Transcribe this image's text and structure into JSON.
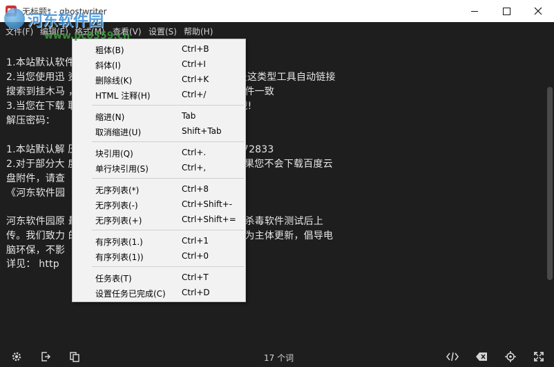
{
  "window": {
    "title": "无标题* - ghostwriter",
    "minimize_icon": "minimize-icon",
    "maximize_icon": "maximize-icon",
    "close_icon": "close-icon"
  },
  "watermark": {
    "text": "河东软件园",
    "url": "www.pc0359.cn"
  },
  "menubar": {
    "items": [
      {
        "label": "文件(F)"
      },
      {
        "label": "编辑(E)"
      },
      {
        "label": "格式(M)"
      },
      {
        "label": "查看(V)"
      },
      {
        "label": "设置(S)"
      },
      {
        "label": "帮助(H)"
      }
    ]
  },
  "editor": {
    "lines": [
      "1.本站默认软件 使用请使用 WinRAR 解压本站软件。",
      "2.当您使用迅 资源，发现MD5值验证不对时，很可能是这类型工具自动链接",
      "搜索到挂木马 ，验证下载后的文件是否与服务器上的文件一致",
      "3.当您在下载 联系QQ：3187272833 寻求解决方法哦!",
      "解压密码：",
      "",
      "1.本站默认解 压密码不正确，请联系客服QQ：3187272833",
      "2.对于部分大 度，我们将附件上传到了百度云盘中，如果您不会下载百度云",
      "盘附件，请查",
      "《河东软件园",
      "",
      "河东软件园原 最安全的绿色软件下载，本站软件均经过杀毒软件测试后上",
      "传。我们致力 的电脑软件深受用户好评，并以绿色软件为主体更新，倡导电",
      "脑环保，不影",
      "详见： http"
    ]
  },
  "context_menu": {
    "groups": [
      [
        {
          "label": "粗体(B)",
          "shortcut": "Ctrl+B"
        },
        {
          "label": "斜体(I)",
          "shortcut": "Ctrl+I"
        },
        {
          "label": "删除线(K)",
          "shortcut": "Ctrl+K"
        },
        {
          "label": "HTML 注释(H)",
          "shortcut": "Ctrl+/"
        }
      ],
      [
        {
          "label": "缩进(N)",
          "shortcut": "Tab"
        },
        {
          "label": "取消缩进(U)",
          "shortcut": "Shift+Tab"
        }
      ],
      [
        {
          "label": "块引用(Q)",
          "shortcut": "Ctrl+."
        },
        {
          "label": "单行块引用(S)",
          "shortcut": "Ctrl+,"
        }
      ],
      [
        {
          "label": "无序列表(*)",
          "shortcut": "Ctrl+8"
        },
        {
          "label": "无序列表(-)",
          "shortcut": "Ctrl+Shift+-"
        },
        {
          "label": "无序列表(+)",
          "shortcut": "Ctrl+Shift+="
        }
      ],
      [
        {
          "label": "有序列表(1.)",
          "shortcut": "Ctrl+1"
        },
        {
          "label": "有序列表(1))",
          "shortcut": "Ctrl+0"
        }
      ],
      [
        {
          "label": "任务表(T)",
          "shortcut": "Ctrl+T"
        },
        {
          "label": "设置任务已完成(C)",
          "shortcut": "Ctrl+D"
        }
      ]
    ]
  },
  "statusbar": {
    "word_count": "17 个词",
    "left_icons": [
      "gear-icon",
      "export-icon",
      "copy-icon"
    ],
    "right_icons": [
      "code-icon",
      "backspace-icon",
      "target-icon",
      "fullscreen-icon"
    ]
  },
  "colors": {
    "background": "#1e1e1e",
    "text": "#e6e6e6",
    "menu_bg": "#f2f2f2"
  }
}
